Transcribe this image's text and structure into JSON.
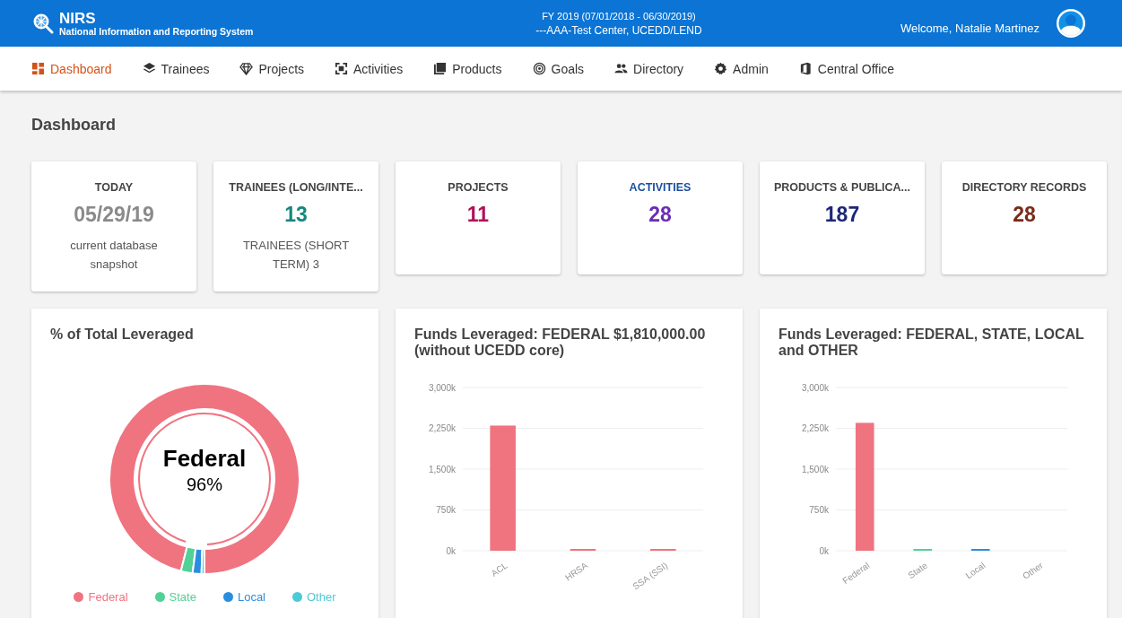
{
  "header": {
    "app_name": "NIRS",
    "app_subtitle": "National Information and Reporting System",
    "fiscal_year": "FY 2019 (07/01/2018 - 06/30/2019)",
    "center": "---AAA-Test Center, UCEDD/LEND",
    "welcome": "Welcome, Natalie Martinez"
  },
  "nav": [
    {
      "label": "Dashboard",
      "selected": true
    },
    {
      "label": "Trainees",
      "selected": false
    },
    {
      "label": "Projects",
      "selected": false
    },
    {
      "label": "Activities",
      "selected": false
    },
    {
      "label": "Products",
      "selected": false
    },
    {
      "label": "Goals",
      "selected": false
    },
    {
      "label": "Directory",
      "selected": false
    },
    {
      "label": "Admin",
      "selected": false
    },
    {
      "label": "Central Office",
      "selected": false
    }
  ],
  "page_title": "Dashboard",
  "stats": [
    {
      "label": "TODAY",
      "value": "05/29/19",
      "note": "current database snapshot",
      "color": "#8a8a8a",
      "hovered": false
    },
    {
      "label": "TRAINEES (LONG/INTE...",
      "value": "13",
      "note": "TRAINEES (SHORT TERM) 3",
      "color": "#17877c",
      "hovered": false
    },
    {
      "label": "PROJECTS",
      "value": "11",
      "color": "#b0125a",
      "hovered": false
    },
    {
      "label": "ACTIVITIES",
      "value": "28",
      "color": "#6a2db5",
      "hovered": true
    },
    {
      "label": "PRODUCTS & PUBLICA...",
      "value": "187",
      "color": "#1c2779",
      "hovered": false
    },
    {
      "label": "DIRECTORY RECORDS",
      "value": "28",
      "color": "#7a2a18",
      "hovered": false
    }
  ],
  "donut_card": {
    "title": "% of Total Leveraged",
    "center_label": "Federal",
    "center_value": "96%",
    "legend": [
      {
        "color": "#f07380"
      },
      {
        "color": "#52d196"
      },
      {
        "color": "#2a8ee0"
      },
      {
        "color": "#4ccad6"
      }
    ],
    "chart_data": {
      "type": "donut",
      "categories": [
        "Federal",
        "State",
        "Local",
        "Other"
      ],
      "values": [
        96,
        2,
        1.5,
        0.5
      ]
    }
  },
  "bar_cards": [
    {
      "title": "Funds Leveraged: FEDERAL $1,810,000.00 (without UCEDD core)",
      "chart_data": {
        "type": "bar",
        "categories": [
          "ACL",
          "HRSA",
          "SSA (SSI)"
        ],
        "grid": true,
        "series": [
          {
            "color": "#f07380",
            "values": [
              2300,
              20,
              30
            ]
          }
        ],
        "ylim": [
          0,
          3000
        ],
        "yticks": [
          {
            "value": 0,
            "label": "0k"
          },
          {
            "value": 750,
            "label": "750k"
          },
          {
            "value": 1500,
            "label": "1,500k"
          },
          {
            "value": 2250,
            "label": "2,250k"
          },
          {
            "value": 3000,
            "label": "3,000k"
          }
        ]
      }
    },
    {
      "title": "Funds Leveraged: FEDERAL, STATE, LOCAL and OTHER",
      "chart_data": {
        "type": "bar",
        "categories": [
          "Federal",
          "State",
          "Local",
          "Other"
        ],
        "grid": true,
        "series": [
          {
            "colors": [
              "#f07380",
              "#52d196",
              "#2a8ee0",
              "#4ccad6"
            ],
            "values": [
              2350,
              30,
              20,
              0
            ]
          }
        ],
        "ylim": [
          0,
          3000
        ],
        "yticks": [
          {
            "value": 0,
            "label": "0k"
          },
          {
            "value": 750,
            "label": "750k"
          },
          {
            "value": 1500,
            "label": "1,500k"
          },
          {
            "value": 2250,
            "label": "2,250k"
          },
          {
            "value": 3000,
            "label": "3,000k"
          }
        ]
      }
    }
  ]
}
